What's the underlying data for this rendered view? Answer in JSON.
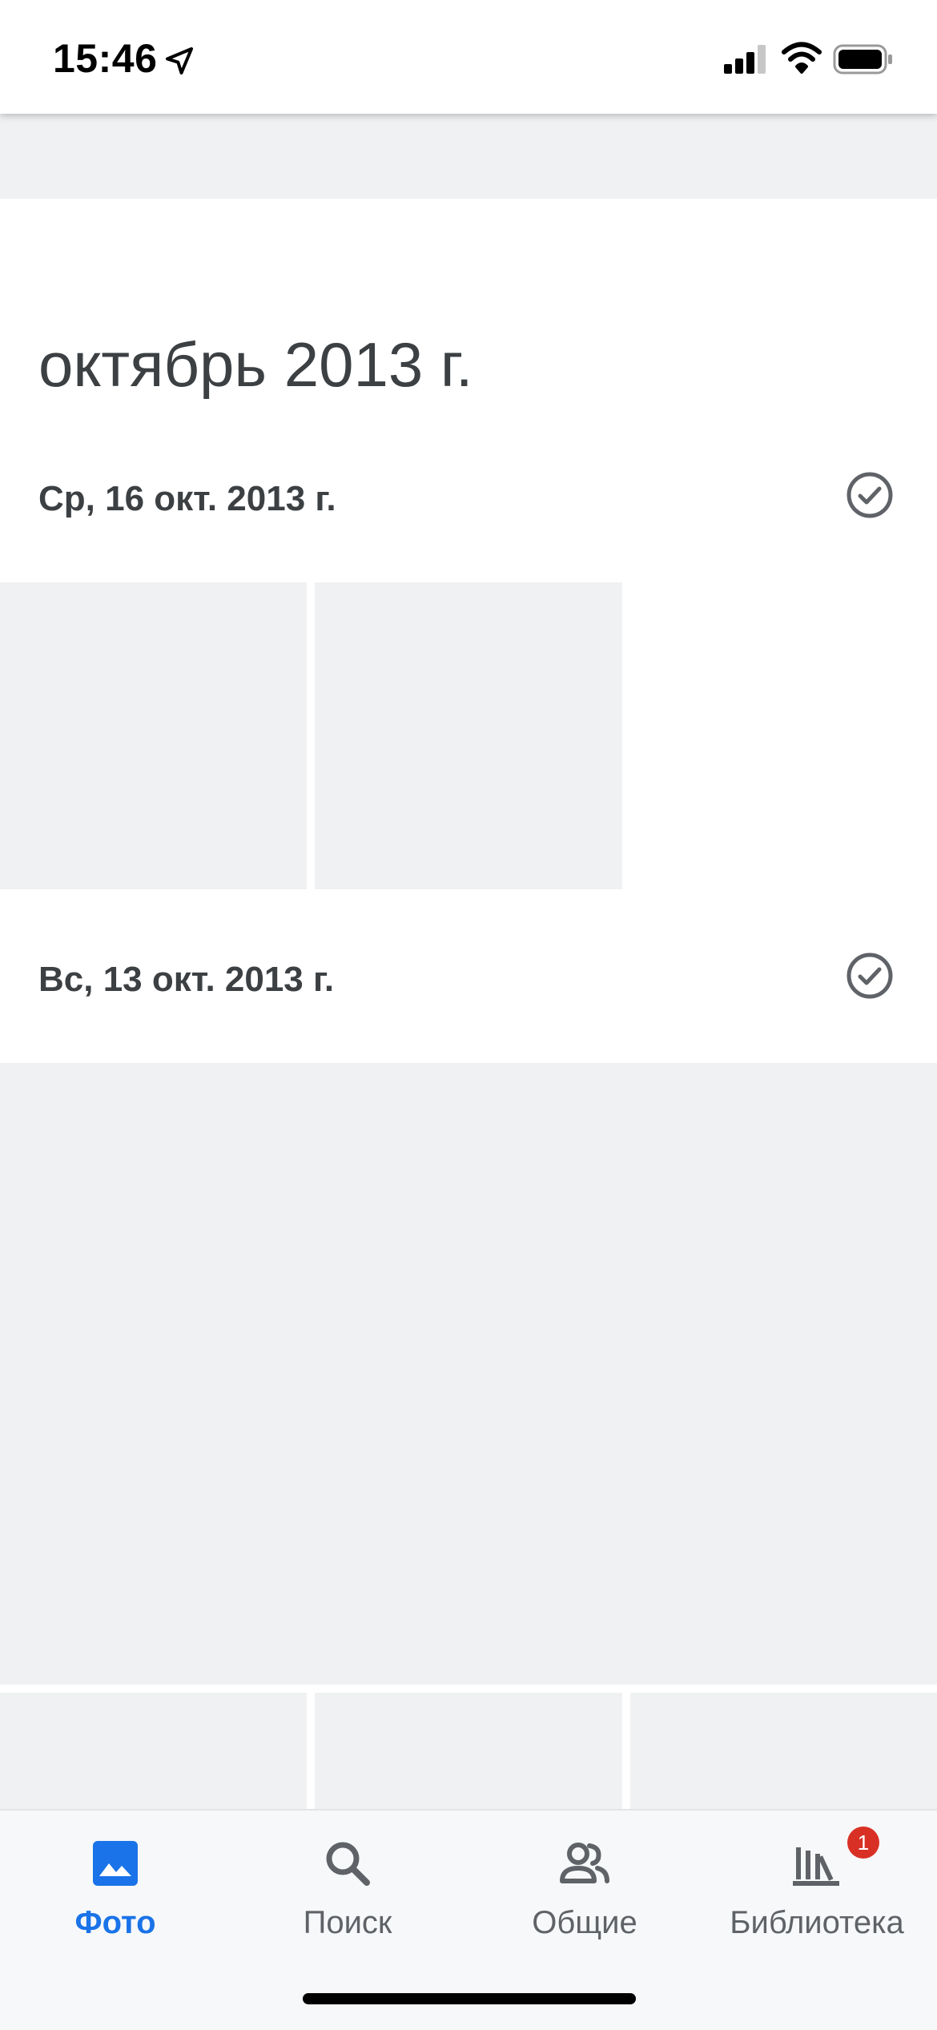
{
  "status_bar": {
    "time": "15:46",
    "icons": [
      "location-arrow-icon",
      "cellular-signal-icon",
      "wifi-icon",
      "battery-icon"
    ]
  },
  "timeline": {
    "month_title": "октябрь 2013 г.",
    "days": [
      {
        "label": "Ср, 16 окт. 2013 г.",
        "select_icon": "check-circle-icon",
        "photo_count": 2
      },
      {
        "label": "Вс, 13 окт. 2013 г.",
        "select_icon": "check-circle-icon",
        "photo_count": 4
      }
    ]
  },
  "bottom_nav": {
    "items": [
      {
        "label": "Фото",
        "icon": "photo-icon",
        "active": true
      },
      {
        "label": "Поиск",
        "icon": "search-icon",
        "active": false
      },
      {
        "label": "Общие",
        "icon": "people-icon",
        "active": false
      },
      {
        "label": "Библиотека",
        "icon": "library-icon",
        "active": false,
        "badge": "1"
      }
    ],
    "active_color": "#1a73e8",
    "inactive_color": "#5f6368",
    "badge_color": "#d93025"
  },
  "placeholder_color": "#f0f1f3"
}
